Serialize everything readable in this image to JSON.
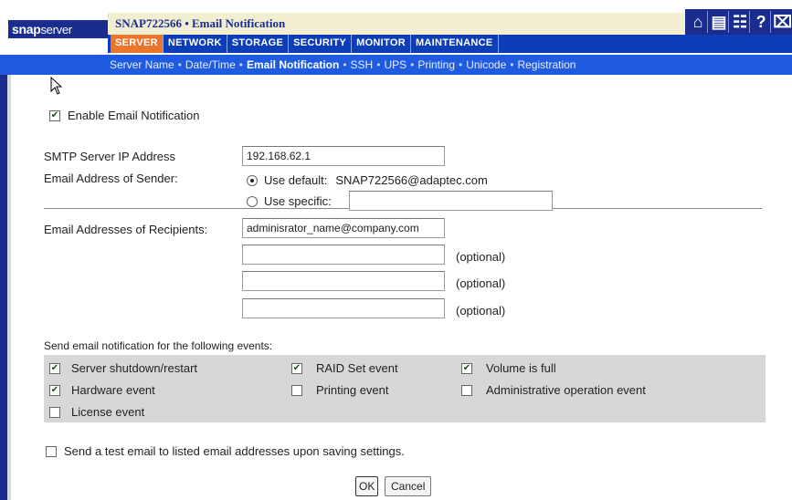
{
  "header": {
    "logo_main": "snap",
    "logo_sub": "server",
    "page_title": "SNAP722566 • Email Notification",
    "tabs": [
      {
        "label": "SERVER",
        "active": true
      },
      {
        "label": "NETWORK",
        "active": false
      },
      {
        "label": "STORAGE",
        "active": false
      },
      {
        "label": "SECURITY",
        "active": false
      },
      {
        "label": "MONITOR",
        "active": false
      },
      {
        "label": "MAINTENANCE",
        "active": false
      }
    ],
    "icons": [
      "home-icon",
      "server-list-icon",
      "network-map-icon",
      "help-icon",
      "logout-icon"
    ],
    "colors": {
      "brand": "#1a2d8f",
      "tab_active": "#e9762a",
      "subnav": "#1e5be0"
    }
  },
  "subnav": {
    "items": [
      {
        "label": "Server Name",
        "current": false
      },
      {
        "label": "Date/Time",
        "current": false
      },
      {
        "label": "Email Notification",
        "current": true
      },
      {
        "label": "SSH",
        "current": false
      },
      {
        "label": "UPS",
        "current": false
      },
      {
        "label": "Printing",
        "current": false
      },
      {
        "label": "Unicode",
        "current": false
      },
      {
        "label": "Registration",
        "current": false
      }
    ]
  },
  "form": {
    "enable_label": "Enable Email Notification",
    "enable_checked": true,
    "smtp_label": "SMTP Server IP Address",
    "smtp_value": "192.168.62.1",
    "sender_label": "Email Address of Sender:",
    "use_default_label": "Use default:",
    "default_address": "SNAP722566@adaptec.com",
    "use_specific_label": "Use specific:",
    "specific_value": "",
    "recipients_label": "Email Addresses of Recipients:",
    "recipients": [
      {
        "value": "adminisrator_name@company.com",
        "note": ""
      },
      {
        "value": "",
        "note": "(optional)"
      },
      {
        "value": "",
        "note": "(optional)"
      },
      {
        "value": "",
        "note": "(optional)"
      }
    ],
    "events_heading": "Send email notification for the following events:",
    "events": [
      {
        "label": "Server shutdown/restart",
        "checked": true
      },
      {
        "label": "RAID Set event",
        "checked": true
      },
      {
        "label": "Volume is full",
        "checked": true
      },
      {
        "label": "Hardware event",
        "checked": true
      },
      {
        "label": "Printing event",
        "checked": false
      },
      {
        "label": "Administrative operation event",
        "checked": false
      },
      {
        "label": "License event",
        "checked": false
      }
    ],
    "test_email_label": "Send a test email to listed email addresses upon saving settings.",
    "test_email_checked": false,
    "ok_label": "OK",
    "cancel_label": "Cancel"
  }
}
